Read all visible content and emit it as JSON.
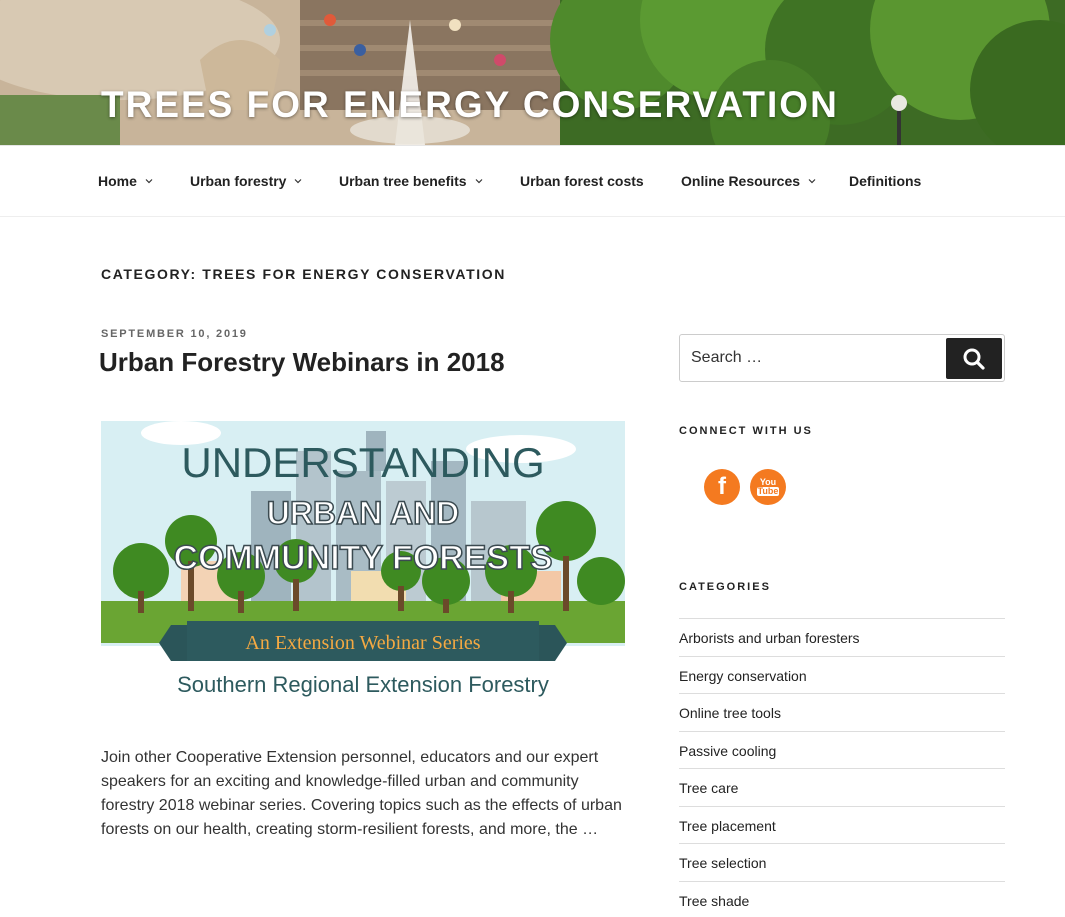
{
  "header": {
    "site_title": "TREES FOR ENERGY CONSERVATION"
  },
  "nav": {
    "items": [
      {
        "label": "Home",
        "has_dropdown": true
      },
      {
        "label": "Urban forestry",
        "has_dropdown": true
      },
      {
        "label": "Urban tree benefits",
        "has_dropdown": true
      },
      {
        "label": "Urban forest costs",
        "has_dropdown": false
      },
      {
        "label": "Online Resources",
        "has_dropdown": true
      },
      {
        "label": "Definitions",
        "has_dropdown": false
      }
    ]
  },
  "archive": {
    "heading": "CATEGORY: TREES FOR ENERGY CONSERVATION"
  },
  "post": {
    "date": "SEPTEMBER 10, 2019",
    "title": "Urban Forestry Webinars in 2018",
    "image_text": {
      "line1": "UNDERSTANDING",
      "line2": "URBAN AND",
      "line3": "COMMUNITY FORESTS",
      "ribbon": "An Extension Webinar Series",
      "footer": "Southern Regional Extension Forestry"
    },
    "excerpt": "Join other Cooperative Extension personnel, educators and our expert speakers for an exciting and knowledge-filled urban and community forestry 2018 webinar series. Covering topics such as the effects of urban forests on our health, creating storm-resilient forests, and more, the …"
  },
  "sidebar": {
    "search": {
      "placeholder": "Search …",
      "button_icon": "search-icon"
    },
    "connect": {
      "title": "CONNECT WITH US",
      "icons": [
        "facebook-icon",
        "youtube-icon"
      ],
      "facebook_glyph": "f",
      "youtube_glyph_top": "You",
      "youtube_glyph_bottom": "Tube",
      "color": "#f47a20"
    },
    "categories": {
      "title": "CATEGORIES",
      "items": [
        "Arborists and urban foresters",
        "Energy conservation",
        "Online tree tools",
        "Passive cooling",
        "Tree care",
        "Tree placement",
        "Tree selection",
        "Tree shade"
      ]
    }
  }
}
